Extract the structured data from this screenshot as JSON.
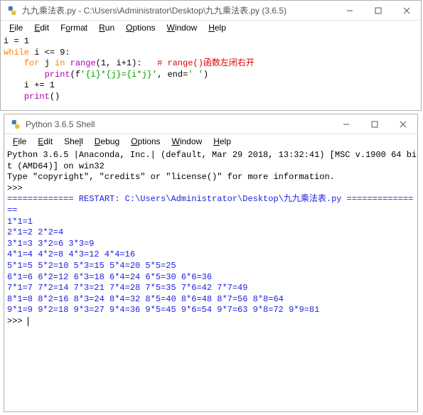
{
  "editor": {
    "title": "九九乘法表.py - C:\\Users\\Administrator\\Desktop\\九九乘法表.py (3.6.5)",
    "menu": [
      "File",
      "Edit",
      "Format",
      "Run",
      "Options",
      "Window",
      "Help"
    ],
    "code": {
      "l1": "i = 1",
      "l2a": "while",
      "l2b": " i <= 9:",
      "l3a": "    for",
      "l3b": " j ",
      "l3c": "in",
      "l3d": " ",
      "l3e": "range",
      "l3f": "(1, i+1):   ",
      "l3g": "# range()函数左闭右开",
      "l4a": "        ",
      "l4b": "print",
      "l4c": "(f",
      "l4d": "'{i}*{j}={i*j}'",
      "l4e": ", end=",
      "l4f": "' '",
      "l4g": ")",
      "l5": "    i += 1",
      "l6a": "    ",
      "l6b": "print",
      "l6c": "()"
    }
  },
  "shell": {
    "title": "Python 3.6.5 Shell",
    "menu": [
      "File",
      "Edit",
      "Shell",
      "Debug",
      "Options",
      "Window",
      "Help"
    ],
    "banner1": "Python 3.6.5 |Anaconda, Inc.| (default, Mar 29 2018, 13:32:41) [MSC v.1900 64 bi",
    "banner2": "t (AMD64)] on win32",
    "banner3": "Type \"copyright\", \"credits\" or \"license()\" for more information.",
    "prompt": ">>> ",
    "restart": "============= RESTART: C:\\Users\\Administrator\\Desktop\\九九乘法表.py =============",
    "o1": "1*1=1 ",
    "o2": "2*1=2 2*2=4 ",
    "o3": "3*1=3 3*2=6 3*3=9 ",
    "o4": "4*1=4 4*2=8 4*3=12 4*4=16 ",
    "o5": "5*1=5 5*2=10 5*3=15 5*4=20 5*5=25 ",
    "o6": "6*1=6 6*2=12 6*3=18 6*4=24 6*5=30 6*6=36 ",
    "o7": "7*1=7 7*2=14 7*3=21 7*4=28 7*5=35 7*6=42 7*7=49 ",
    "o8": "8*1=8 8*2=16 8*3=24 8*4=32 8*5=40 8*6=48 8*7=56 8*8=64 ",
    "o9": "9*1=9 9*2=18 9*3=27 9*4=36 9*5=45 9*6=54 9*7=63 9*8=72 9*9=81 ",
    "tail": "=="
  }
}
